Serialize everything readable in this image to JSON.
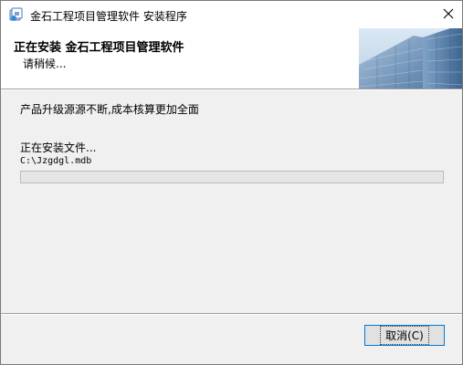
{
  "window": {
    "title": "金石工程项目管理软件 安装程序",
    "close_icon": "close-icon",
    "app_icon": "installer-icon"
  },
  "header": {
    "title": "正在安装 金石工程项目管理软件",
    "subtitle": "请稍候..."
  },
  "content": {
    "description": "产品升级源源不断,成本核算更加全面",
    "status": "正在安装文件...",
    "file_path": "C:\\Jzgdgl.mdb",
    "progress": 0
  },
  "footer": {
    "cancel_label": "取消(C)"
  },
  "colors": {
    "button_border": "#0078d7",
    "progress_fill": "#06b025"
  }
}
